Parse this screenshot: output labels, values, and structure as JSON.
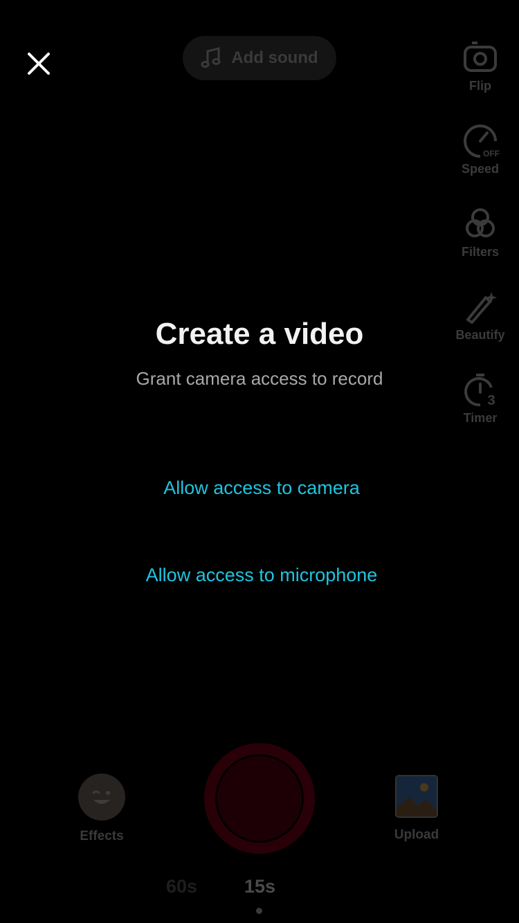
{
  "header": {
    "close_icon": "close-icon",
    "add_sound_icon": "music-note-icon",
    "add_sound_label": "Add sound"
  },
  "side_tools": [
    {
      "label": "Flip",
      "icon": "flip-camera-icon"
    },
    {
      "label": "Speed",
      "icon": "speed-icon",
      "badge": "OFF"
    },
    {
      "label": "Filters",
      "icon": "filters-icon"
    },
    {
      "label": "Beautify",
      "icon": "magic-wand-icon"
    },
    {
      "label": "Timer",
      "icon": "timer-icon",
      "badge": "3"
    }
  ],
  "main": {
    "title": "Create a video",
    "subtitle": "Grant camera access to record",
    "allow_camera": "Allow access to camera",
    "allow_microphone": "Allow access to microphone"
  },
  "bottom": {
    "effects_label": "Effects",
    "effects_icon": "winking-face-icon",
    "upload_label": "Upload",
    "upload_icon": "image-thumbnail-icon",
    "record_icon": "record-button",
    "durations": [
      "60s",
      "15s"
    ],
    "selected_duration": "15s"
  },
  "colors": {
    "background": "#000000",
    "link": "#20c4e0",
    "record": "#2a0008"
  }
}
